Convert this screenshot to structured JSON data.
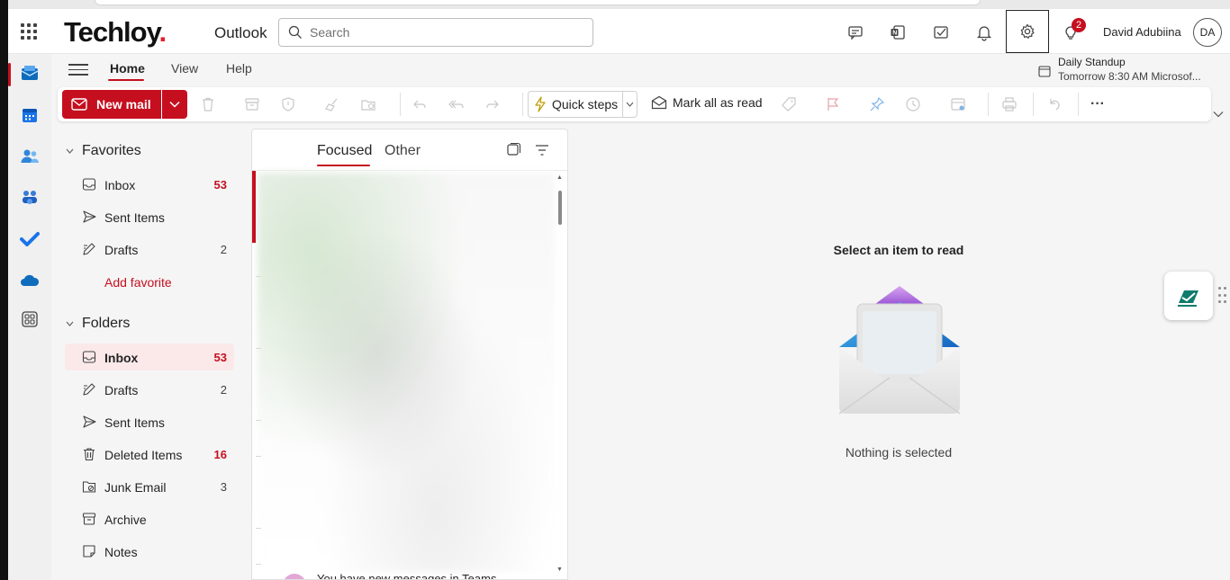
{
  "header": {
    "logo_text": "Techloy",
    "logo_dot": ".",
    "app_name": "Outlook",
    "search_placeholder": "Search",
    "notification_count": "2",
    "user_name": "David Adubiina",
    "user_initials": "DA",
    "icons": [
      "app-launcher-icon",
      "chat-icon",
      "onenote-icon",
      "todo-icon",
      "bell-icon",
      "gear-icon",
      "lightbulb-icon"
    ]
  },
  "rail": {
    "items": [
      "mail-icon",
      "calendar-icon",
      "people-icon",
      "teams-icon",
      "todo-check-icon",
      "onedrive-icon",
      "more-apps-icon"
    ]
  },
  "ribbon": {
    "tabs": [
      "Home",
      "View",
      "Help"
    ],
    "active_tab": "Home",
    "new_mail": "New mail",
    "quick_steps": "Quick steps",
    "mark_all_read": "Mark all as read",
    "more": "···"
  },
  "reminder": {
    "title": "Daily Standup",
    "detail": "Tomorrow 8:30 AM Microsof..."
  },
  "folders": {
    "favorites_label": "Favorites",
    "favorites": [
      {
        "name": "Inbox",
        "count": "53",
        "highlight": true
      },
      {
        "name": "Sent Items",
        "count": ""
      },
      {
        "name": "Drafts",
        "count": "2"
      }
    ],
    "add_favorite": "Add favorite",
    "folders_label": "Folders",
    "items": [
      {
        "name": "Inbox",
        "count": "53",
        "highlight": true,
        "selected": true
      },
      {
        "name": "Drafts",
        "count": "2"
      },
      {
        "name": "Sent Items",
        "count": ""
      },
      {
        "name": "Deleted Items",
        "count": "16",
        "highlight": true
      },
      {
        "name": "Junk Email",
        "count": "3"
      },
      {
        "name": "Archive",
        "count": ""
      },
      {
        "name": "Notes",
        "count": ""
      }
    ]
  },
  "message_list": {
    "tabs": [
      "Focused",
      "Other"
    ],
    "active_tab": "Focused",
    "peek_text": "You have new messages in Teams"
  },
  "reading_pane": {
    "title": "Select an item to read",
    "subtitle": "Nothing is selected"
  },
  "colors": {
    "accent": "#c50f1f",
    "selected_bg": "#fbe9ea"
  }
}
